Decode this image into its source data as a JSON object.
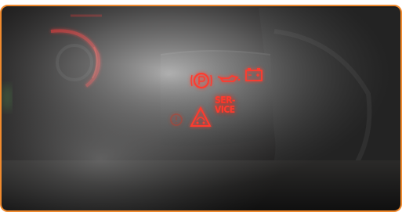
{
  "dashboard": {
    "warning_lights": [
      {
        "name": "parking-brake-icon",
        "state": "on"
      },
      {
        "name": "oil-pressure-icon",
        "state": "on"
      },
      {
        "name": "battery-icon",
        "state": "on"
      },
      {
        "name": "low-tire-pressure-icon",
        "state": "dim"
      },
      {
        "name": "stability-control-icon",
        "state": "on"
      }
    ],
    "service_line1": "SER-",
    "service_line2": "VICE",
    "accent_color": "#ff3b2e",
    "frame_border_color": "#f08a2e"
  }
}
